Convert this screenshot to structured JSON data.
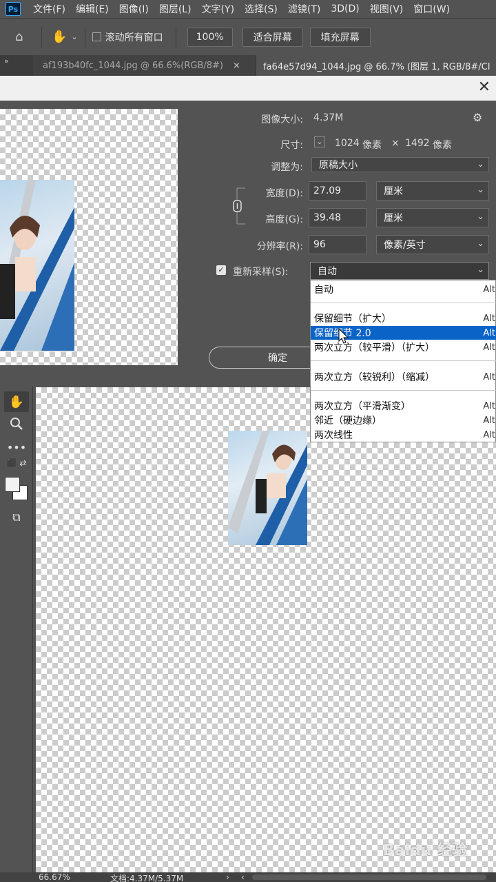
{
  "app": {
    "logo": "Ps"
  },
  "menu": [
    "文件(F)",
    "编辑(E)",
    "图像(I)",
    "图层(L)",
    "文字(Y)",
    "选择(S)",
    "滤镜(T)",
    "3D(D)",
    "视图(V)",
    "窗口(W)"
  ],
  "options": {
    "scroll_all_label": "滚动所有窗口",
    "zoom_value": "100%",
    "fit_screen_label": "适合屏幕",
    "fill_screen_label": "填充屏幕"
  },
  "tabs": [
    {
      "label": "af193b40fc_1044.jpg @ 66.6%(RGB/8#)"
    },
    {
      "label": "fa64e57d94_1044.jpg @ 66.7% (图层 1, RGB/8#/CI"
    }
  ],
  "dialog": {
    "image_size_label": "图像大小:",
    "image_size_value": "4.37M",
    "dimensions_label": "尺寸:",
    "dimensions_width": "1024",
    "dimensions_height": "1492",
    "dimensions_unit": "像素",
    "dimensions_times": "×",
    "fit_to_label": "调整为:",
    "fit_to_value": "原稿大小",
    "width_label": "宽度(D):",
    "width_value": "27.09",
    "width_unit": "厘米",
    "height_label": "高度(G):",
    "height_value": "39.48",
    "height_unit": "厘米",
    "resolution_label": "分辨率(R):",
    "resolution_value": "96",
    "resolution_unit": "像素/英寸",
    "resample_label": "重新采样(S):",
    "resample_value": "自动",
    "ok_label": "确定"
  },
  "dropdown": {
    "items": [
      {
        "label": "自动",
        "shortcut": "Alt"
      },
      {
        "label": "保留细节（扩大）",
        "shortcut": "Alt"
      },
      {
        "label": "保留细节 2.0",
        "shortcut": "Alt"
      },
      {
        "label": "两次立方（较平滑）（扩大）",
        "shortcut": "Alt"
      },
      {
        "label": "两次立方（较锐利）（缩减）",
        "shortcut": "Alt"
      },
      {
        "label": "两次立方（平滑渐变）",
        "shortcut": "Alt"
      },
      {
        "label": "邻近（硬边缘）",
        "shortcut": "Alt"
      },
      {
        "label": "两次线性",
        "shortcut": "Alt"
      }
    ],
    "selected_index": 2
  },
  "status": {
    "zoom": "66.67%",
    "doc": "文档:4.37M/5.37M"
  },
  "watermark": "Baidu 经验",
  "colors": {
    "accent": "#0a64c8",
    "panel": "#535353"
  }
}
